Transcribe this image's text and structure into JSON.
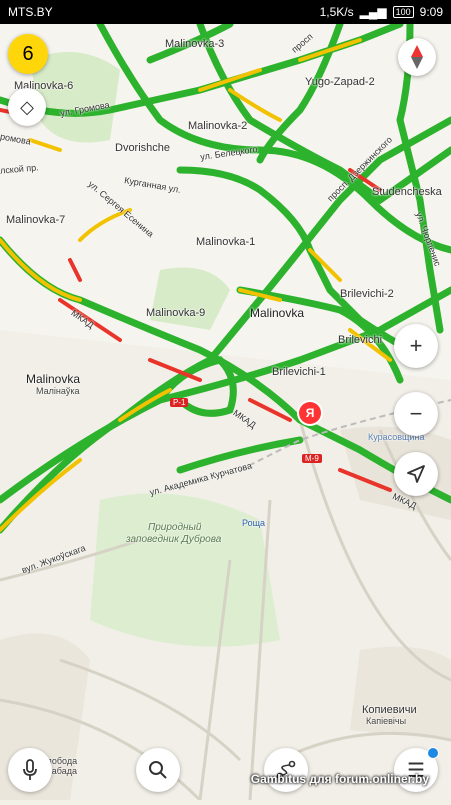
{
  "status_bar": {
    "carrier": "MTS.BY",
    "net_speed": "1,5K/s",
    "battery": "100",
    "time": "9:09"
  },
  "traffic_level": "6",
  "map": {
    "labels": {
      "malinovka_3": "Malinovka-3",
      "malinovka_6": "Malinovka-6",
      "malinovka_2": "Malinovka-2",
      "malinovka_1": "Malinovka-1",
      "malinovka_7": "Malinovka-7",
      "malinovka_9": "Malinovka-9",
      "malinovka_metro": "Malinovka",
      "malinovka_village": "Malinovka",
      "malinovka_village_by": "Малінаўка",
      "yugo_zapad": "Yugo-Zapad-2",
      "dvorishche": "Dvorishche",
      "studencheskaya": "Studencheska",
      "brilevichi_2": "Brilevichi-2",
      "brilevichi_1": "Brilevichi-1",
      "brilevichi_east": "Brilevichi",
      "kurasovshchina": "Курасовщина",
      "roshcha": "Роща",
      "reserve_1": "Природный",
      "reserve_2": "заповедник Дуброва",
      "kopievichi": "Копиевичи",
      "kopievichi_by": "Капіевічы",
      "sloboda": "Слобода",
      "sloboda_by": "Слабада",
      "street_gromova": "ул. Громова",
      "street_beletskogo": "ул. Белецкого",
      "street_dzerzhinskogo": "просп. Дзержинского",
      "street_prosp": "просп",
      "street_chyurlenisa": "ул. Чюрленис",
      "street_esenina": "ул. Сергея Есенина",
      "street_kurganna": "Курганная ул.",
      "street_akademika_kurchatova": "ул. Академика Курчатова",
      "street_zhukovskogo": "вул. Жукоўскага",
      "street_lskoy": "лской пр.",
      "street_romova": "ромова",
      "mkad_1": "МКАД",
      "mkad_2": "МКАД",
      "mkad_3": "МКАД",
      "road_p1": "Р-1",
      "road_m9": "М-9"
    }
  },
  "pin_label": "Я",
  "controls": {
    "zoom_in": "+",
    "zoom_out": "−"
  },
  "watermark": "Gambitus для forum.onliner.by",
  "colors": {
    "traffic_green": "#2cb22c",
    "traffic_yellow": "#f2c200",
    "traffic_red": "#e8342a",
    "badge_yellow": "#ffd60a",
    "pin_red": "#ff3333"
  }
}
